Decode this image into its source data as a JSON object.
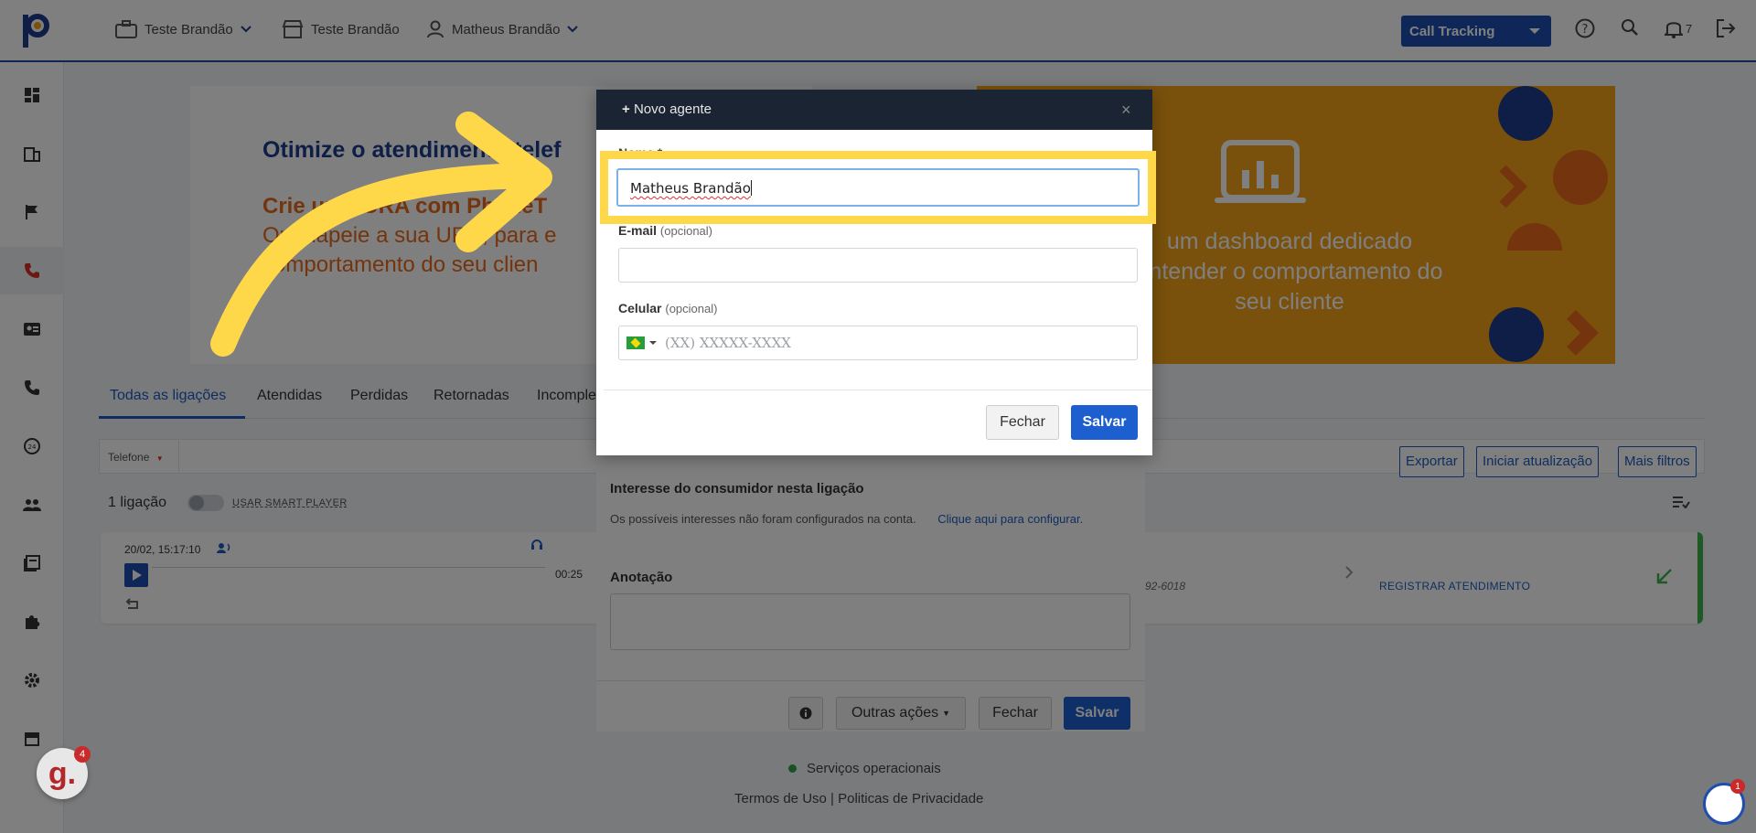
{
  "topbar": {
    "company_1": "Teste Brandão",
    "company_2": "Teste Brandão",
    "user": "Matheus Brandão",
    "product_select": "Call Tracking",
    "notification_count": "7"
  },
  "banner": {
    "title": "Otimize o atendimento telef",
    "subtitle_line1": "Crie uma URA com PhoneT",
    "subtitle_line2": "Ou mapeie a sua URA, para e",
    "subtitle_line3": "comportamento do seu clien",
    "right_text": "um dashboard dedicado entender o comportamento do seu cliente",
    "accent_color": "#f5a319"
  },
  "tabs": [
    {
      "label": "Todas as ligações"
    },
    {
      "label": "Atendidas"
    },
    {
      "label": "Perdidas"
    },
    {
      "label": "Retornadas"
    },
    {
      "label": "Incomple"
    }
  ],
  "filters": {
    "phone_select": "Telefone",
    "export": "Exportar",
    "start_update": "Iniciar atualização",
    "more_filters": "Mais filtros"
  },
  "calls": {
    "count": "1 ligação",
    "smart_player": "USAR SMART PLAYER",
    "row": {
      "date": "20/02, 15:17:10",
      "duration": "00:25",
      "phone_fragment": "92-6018",
      "register": "REGISTRAR ATENDIMENTO"
    }
  },
  "modal_behind": {
    "interest_label": "Interesse do consumidor nesta ligação",
    "interest_note": "Os possíveis interesses não foram configurados na conta.",
    "interest_link": "Clique aqui para configurar.",
    "annotation_label": "Anotação",
    "other_actions": "Outras ações",
    "close": "Fechar",
    "save": "Salvar"
  },
  "modal": {
    "title": "Novo agente",
    "close_icon": "×",
    "name_label": "Nome *",
    "name_value": "Matheus Brandão",
    "email_label": "E-mail",
    "email_optional": "(opcional)",
    "email_value": "",
    "phone_label": "Celular",
    "phone_optional": "(opcional)",
    "phone_placeholder": "(XX) XXXXX-XXXX",
    "close_button": "Fechar",
    "save_button": "Salvar"
  },
  "footer": {
    "status": "Serviços operacionais",
    "terms": "Termos de Uso",
    "separator": "|",
    "privacy": "Politicas de Privacidade"
  },
  "widgets": {
    "g_badge_letter": "g.",
    "g_badge_count": "4",
    "chat_count": "1"
  }
}
